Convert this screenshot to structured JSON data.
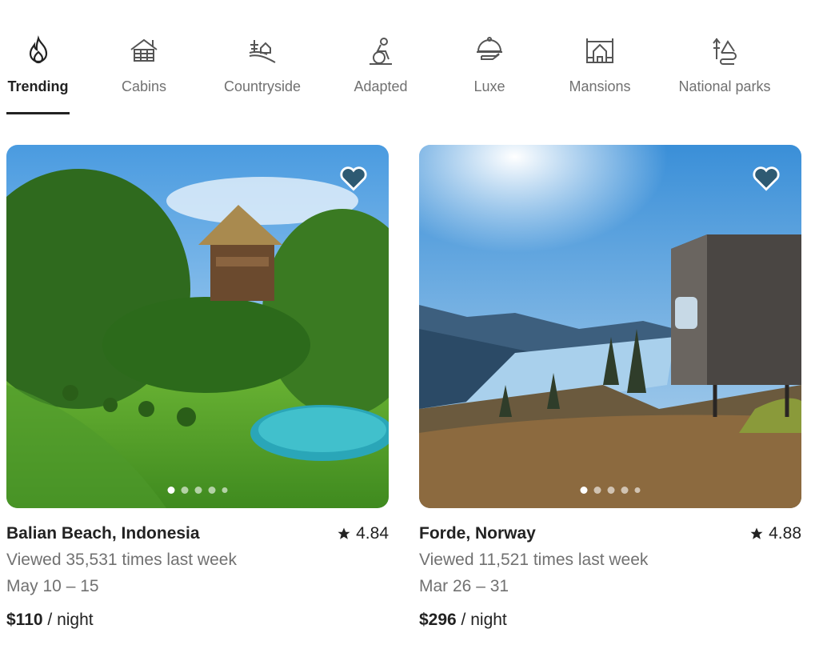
{
  "categories": [
    {
      "label": "Trending",
      "icon": "flame-icon",
      "active": true
    },
    {
      "label": "Cabins",
      "icon": "cabin-icon",
      "active": false
    },
    {
      "label": "Countryside",
      "icon": "countryside-icon",
      "active": false
    },
    {
      "label": "Adapted",
      "icon": "wheelchair-icon",
      "active": false
    },
    {
      "label": "Luxe",
      "icon": "cloche-icon",
      "active": false
    },
    {
      "label": "Mansions",
      "icon": "mansion-icon",
      "active": false
    },
    {
      "label": "National parks",
      "icon": "national-park-icon",
      "active": false
    }
  ],
  "listings": [
    {
      "title": "Balian Beach, Indonesia",
      "rating": "4.84",
      "views": "Viewed 35,531 times last week",
      "dates": "May 10 – 15",
      "price": "$110",
      "price_unit": " / night",
      "photo_count": 5,
      "active_photo": 1
    },
    {
      "title": "Forde, Norway",
      "rating": "4.88",
      "views": "Viewed 11,521 times last week",
      "dates": "Mar 26 – 31",
      "price": "$296",
      "price_unit": " / night",
      "photo_count": 5,
      "active_photo": 1
    }
  ],
  "colors": {
    "accent_text": "#222222",
    "muted_text": "#717171",
    "heart_fill": "#2e5a72"
  }
}
